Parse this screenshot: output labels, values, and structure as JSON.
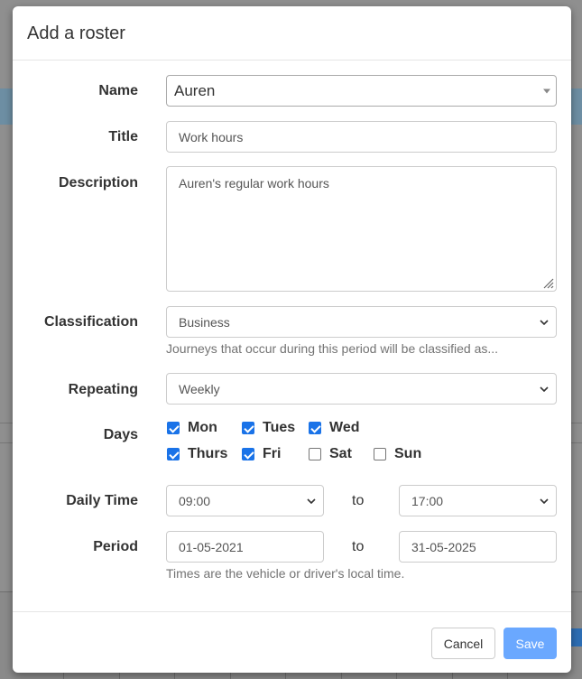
{
  "modal": {
    "title": "Add a roster",
    "name": {
      "label": "Name",
      "value": "Auren"
    },
    "title_field": {
      "label": "Title",
      "value": "Work hours"
    },
    "description": {
      "label": "Description",
      "value": "Auren's regular work hours"
    },
    "classification": {
      "label": "Classification",
      "value": "Business",
      "help": "Journeys that occur during this period will be classified as..."
    },
    "repeating": {
      "label": "Repeating",
      "value": "Weekly"
    },
    "days": {
      "label": "Days",
      "items": [
        {
          "label": "Mon",
          "checked": true
        },
        {
          "label": "Tues",
          "checked": true
        },
        {
          "label": "Wed",
          "checked": true
        },
        {
          "label": "Thurs",
          "checked": true
        },
        {
          "label": "Fri",
          "checked": true
        },
        {
          "label": "Sat",
          "checked": false
        },
        {
          "label": "Sun",
          "checked": false
        }
      ]
    },
    "daily_time": {
      "label": "Daily Time",
      "from": "09:00",
      "to_word": "to",
      "to": "17:00"
    },
    "period": {
      "label": "Period",
      "from": "01-05-2021",
      "to_word": "to",
      "to": "31-05-2025",
      "help": "Times are the vehicle or driver's local time."
    },
    "buttons": {
      "cancel": "Cancel",
      "save": "Save"
    }
  },
  "colors": {
    "accent": "#1a73e8",
    "save_button": "#6aa8ff"
  },
  "icons": {
    "dropdown": "chevron-down-icon",
    "name_caret": "caret-down-icon",
    "checkbox": "check-icon",
    "textarea": "resize-grip-icon"
  }
}
